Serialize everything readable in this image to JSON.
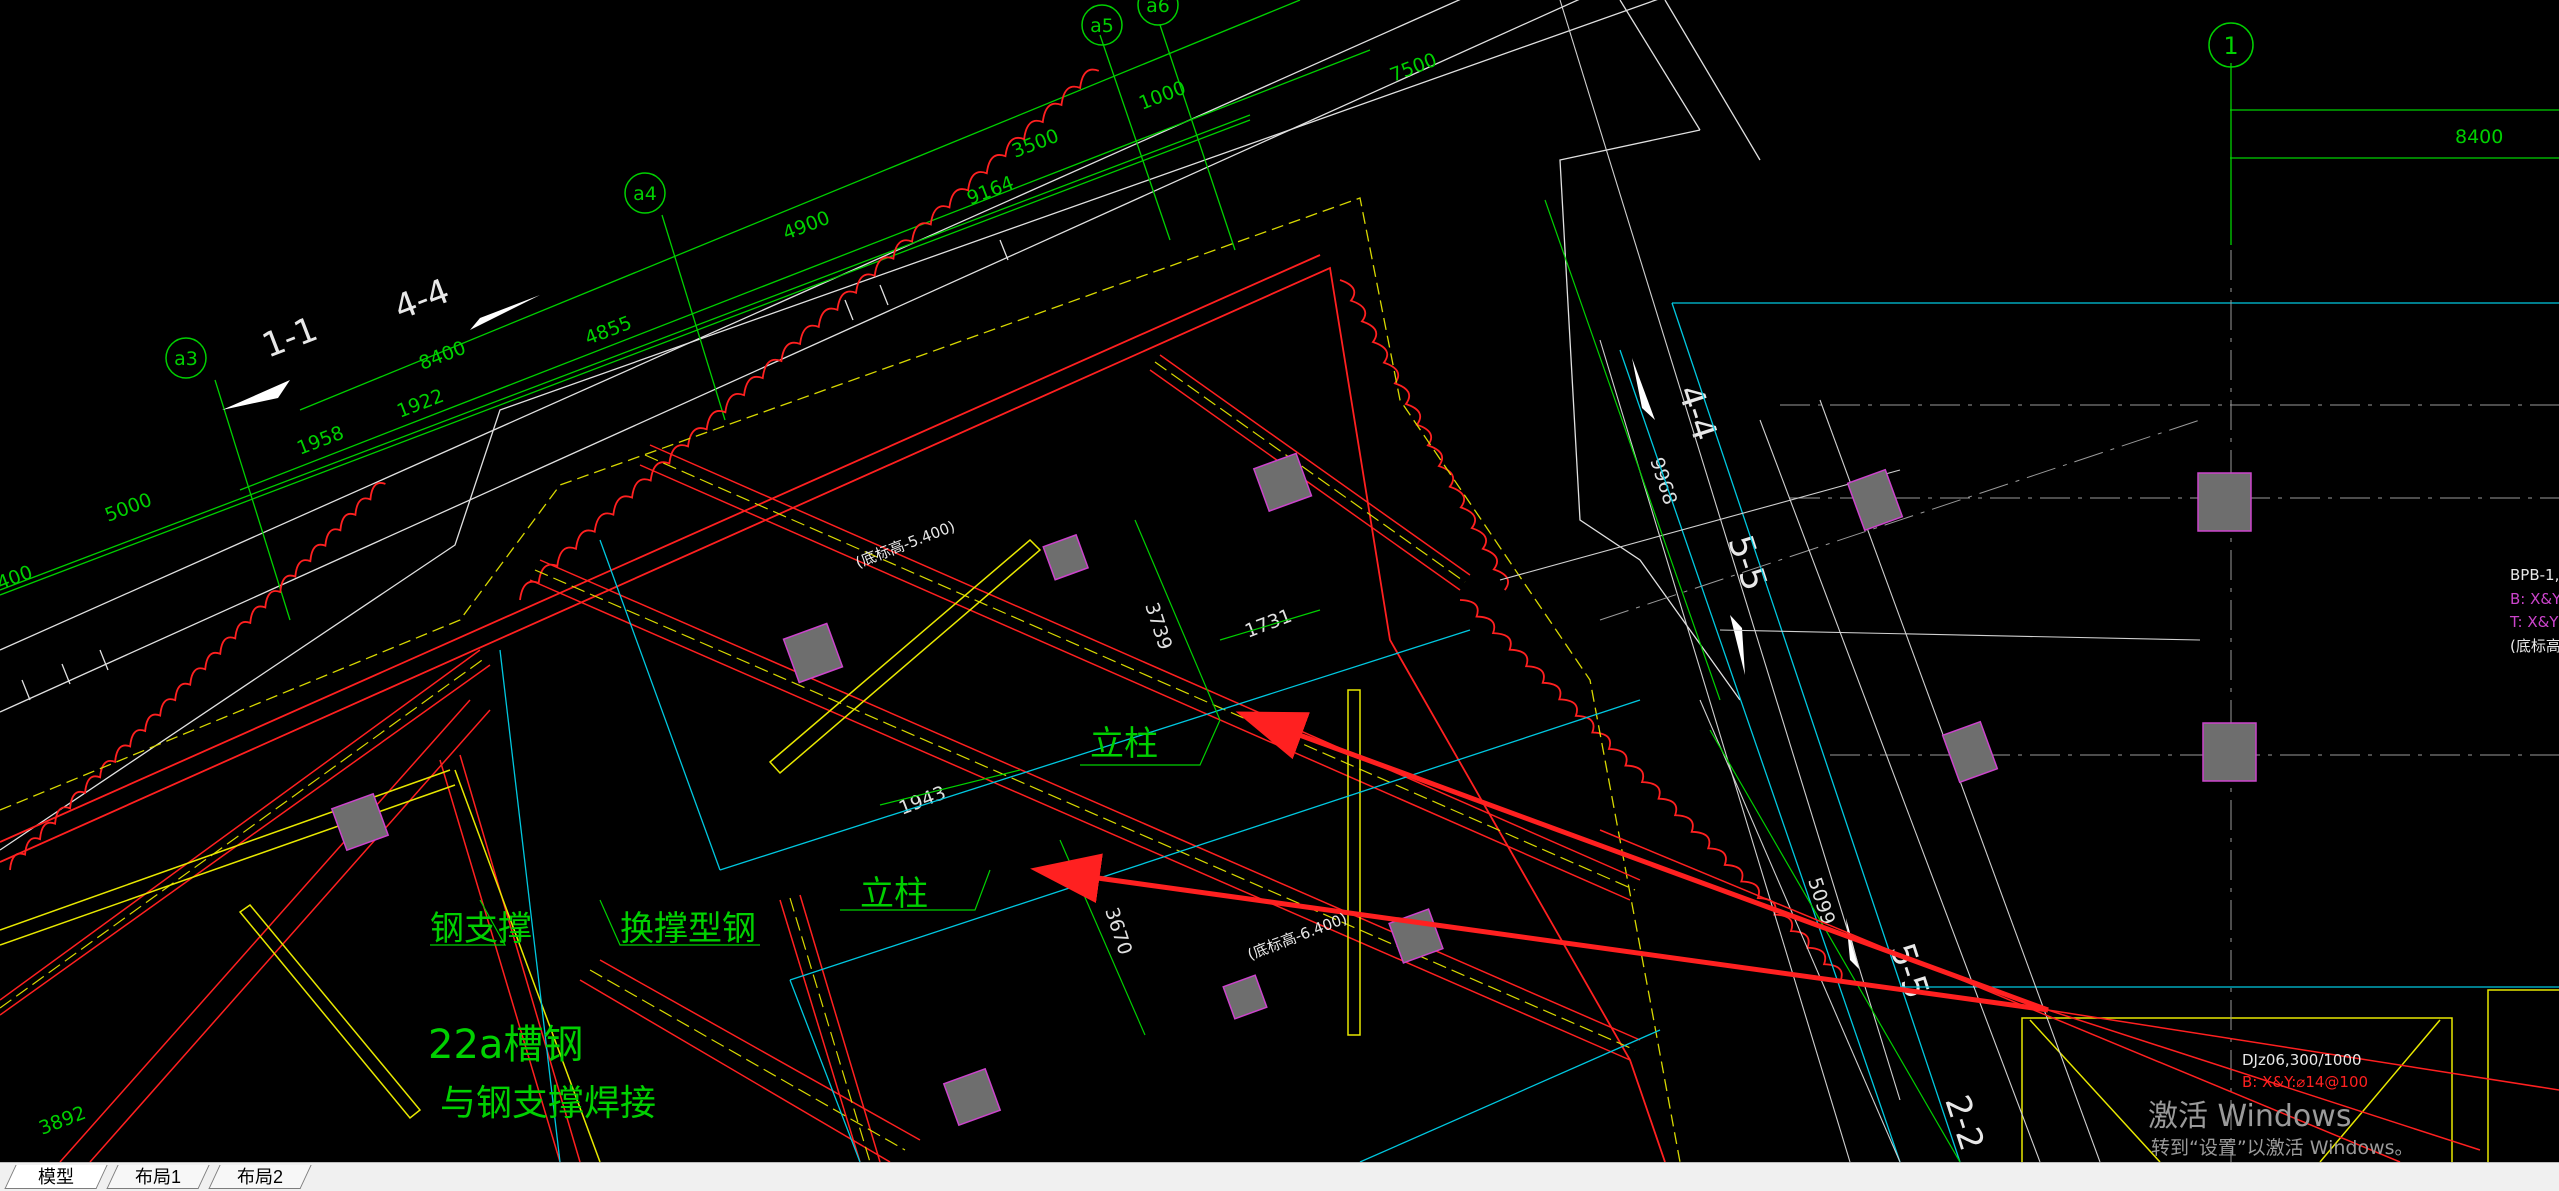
{
  "tabs": [
    {
      "label": "模型",
      "active": true
    },
    {
      "label": "布局1",
      "active": false
    },
    {
      "label": "布局2",
      "active": false
    }
  ],
  "watermark": {
    "line1": "激活 Windows",
    "line2": "转到“设置”以激活 Windows。"
  },
  "axes": {
    "a3": "a3",
    "a4": "a4",
    "a5": "a5",
    "a6": "a6",
    "one": "1"
  },
  "dimensions": {
    "d5000": "5000",
    "d1958": "1958",
    "d1922": "1922",
    "d8400a": "8400",
    "d4855": "4855",
    "d4900": "4900",
    "d9164": "9164",
    "d3500": "3500",
    "d1000": "1000",
    "d7500": "7500",
    "d8400b": "8400",
    "d3892": "3892",
    "d3739": "3739",
    "d1731": "1731",
    "d1943": "1943",
    "d3670": "3670",
    "d9968": "9968",
    "d5099": "5099",
    "d400": "400"
  },
  "sections": {
    "s11": "1-1",
    "s44": "4-4",
    "s44b": "4-4",
    "s55": "5-5",
    "s55b": "5-5",
    "s22": "2-2"
  },
  "annotations": {
    "elev1": "(底标高-5.400)",
    "elev2": "(底标高-6.400)",
    "col1": "立柱",
    "col2": "立柱",
    "steel_brace": "钢支撑",
    "replace_steel": "换撑型钢",
    "channel1": "22a槽钢",
    "channel2": "与钢支撑焊接",
    "bpb": "BPB-1,(",
    "bx": "B: X&Y",
    "tx": "T: X&Y",
    "elev3": "(底标高-2",
    "djz": "DJz06,300/1000",
    "bxy": "B: X&Y:⌀14@100"
  },
  "colors": {
    "green": "#00ff00",
    "red": "#ff2020",
    "yellow": "#e8e800",
    "cyan": "#00d8e8",
    "white": "#e8e8e8",
    "magenta": "#cc44cc",
    "gray": "#6e6e6e"
  }
}
